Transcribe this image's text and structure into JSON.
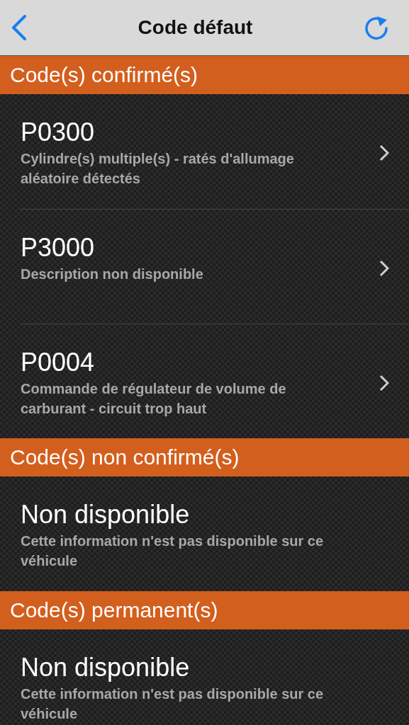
{
  "nav": {
    "title": "Code défaut"
  },
  "sections": [
    {
      "title": "Code(s) confirmé(s)",
      "rows": [
        {
          "kind": "code",
          "code": "P0300",
          "description": "Cylindre(s) multiple(s) - ratés d'allumage aléatoire détectés"
        },
        {
          "kind": "code",
          "code": "P3000",
          "description": "Description non disponible"
        },
        {
          "kind": "code",
          "code": "P0004",
          "description": "Commande de régulateur de volume de carburant - circuit trop haut"
        }
      ]
    },
    {
      "title": "Code(s) non confirmé(s)",
      "rows": [
        {
          "kind": "note",
          "code": "Non disponible",
          "description": "Cette information n'est pas disponible sur ce véhicule"
        }
      ]
    },
    {
      "title": "Code(s) permanent(s)",
      "rows": [
        {
          "kind": "note",
          "code": "Non disponible",
          "description": "Cette information n'est pas disponible sur ce véhicule"
        }
      ]
    }
  ]
}
